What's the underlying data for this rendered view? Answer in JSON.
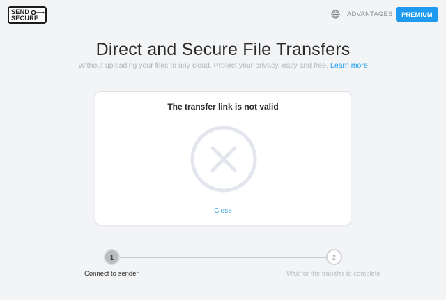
{
  "header": {
    "logo_line1": "SEND",
    "logo_line2": "SECURE",
    "nav_advantages": "ADVANTAGES",
    "premium_label": "PREMIUM",
    "accent_color": "#1e9bf0"
  },
  "hero": {
    "title": "Direct and Secure File Transfers",
    "subtitle": "Without uploading your files to any cloud. Protect your privacy, easy and free.",
    "learn_more": "Learn more"
  },
  "card": {
    "message": "The transfer link is not valid",
    "icon": "error-x-circle-icon",
    "close_label": "Close"
  },
  "stepper": {
    "steps": [
      {
        "number": "1",
        "label": "Connect to sender",
        "active": true
      },
      {
        "number": "2",
        "label": "Wait for the transfer to complete",
        "active": false
      }
    ]
  }
}
